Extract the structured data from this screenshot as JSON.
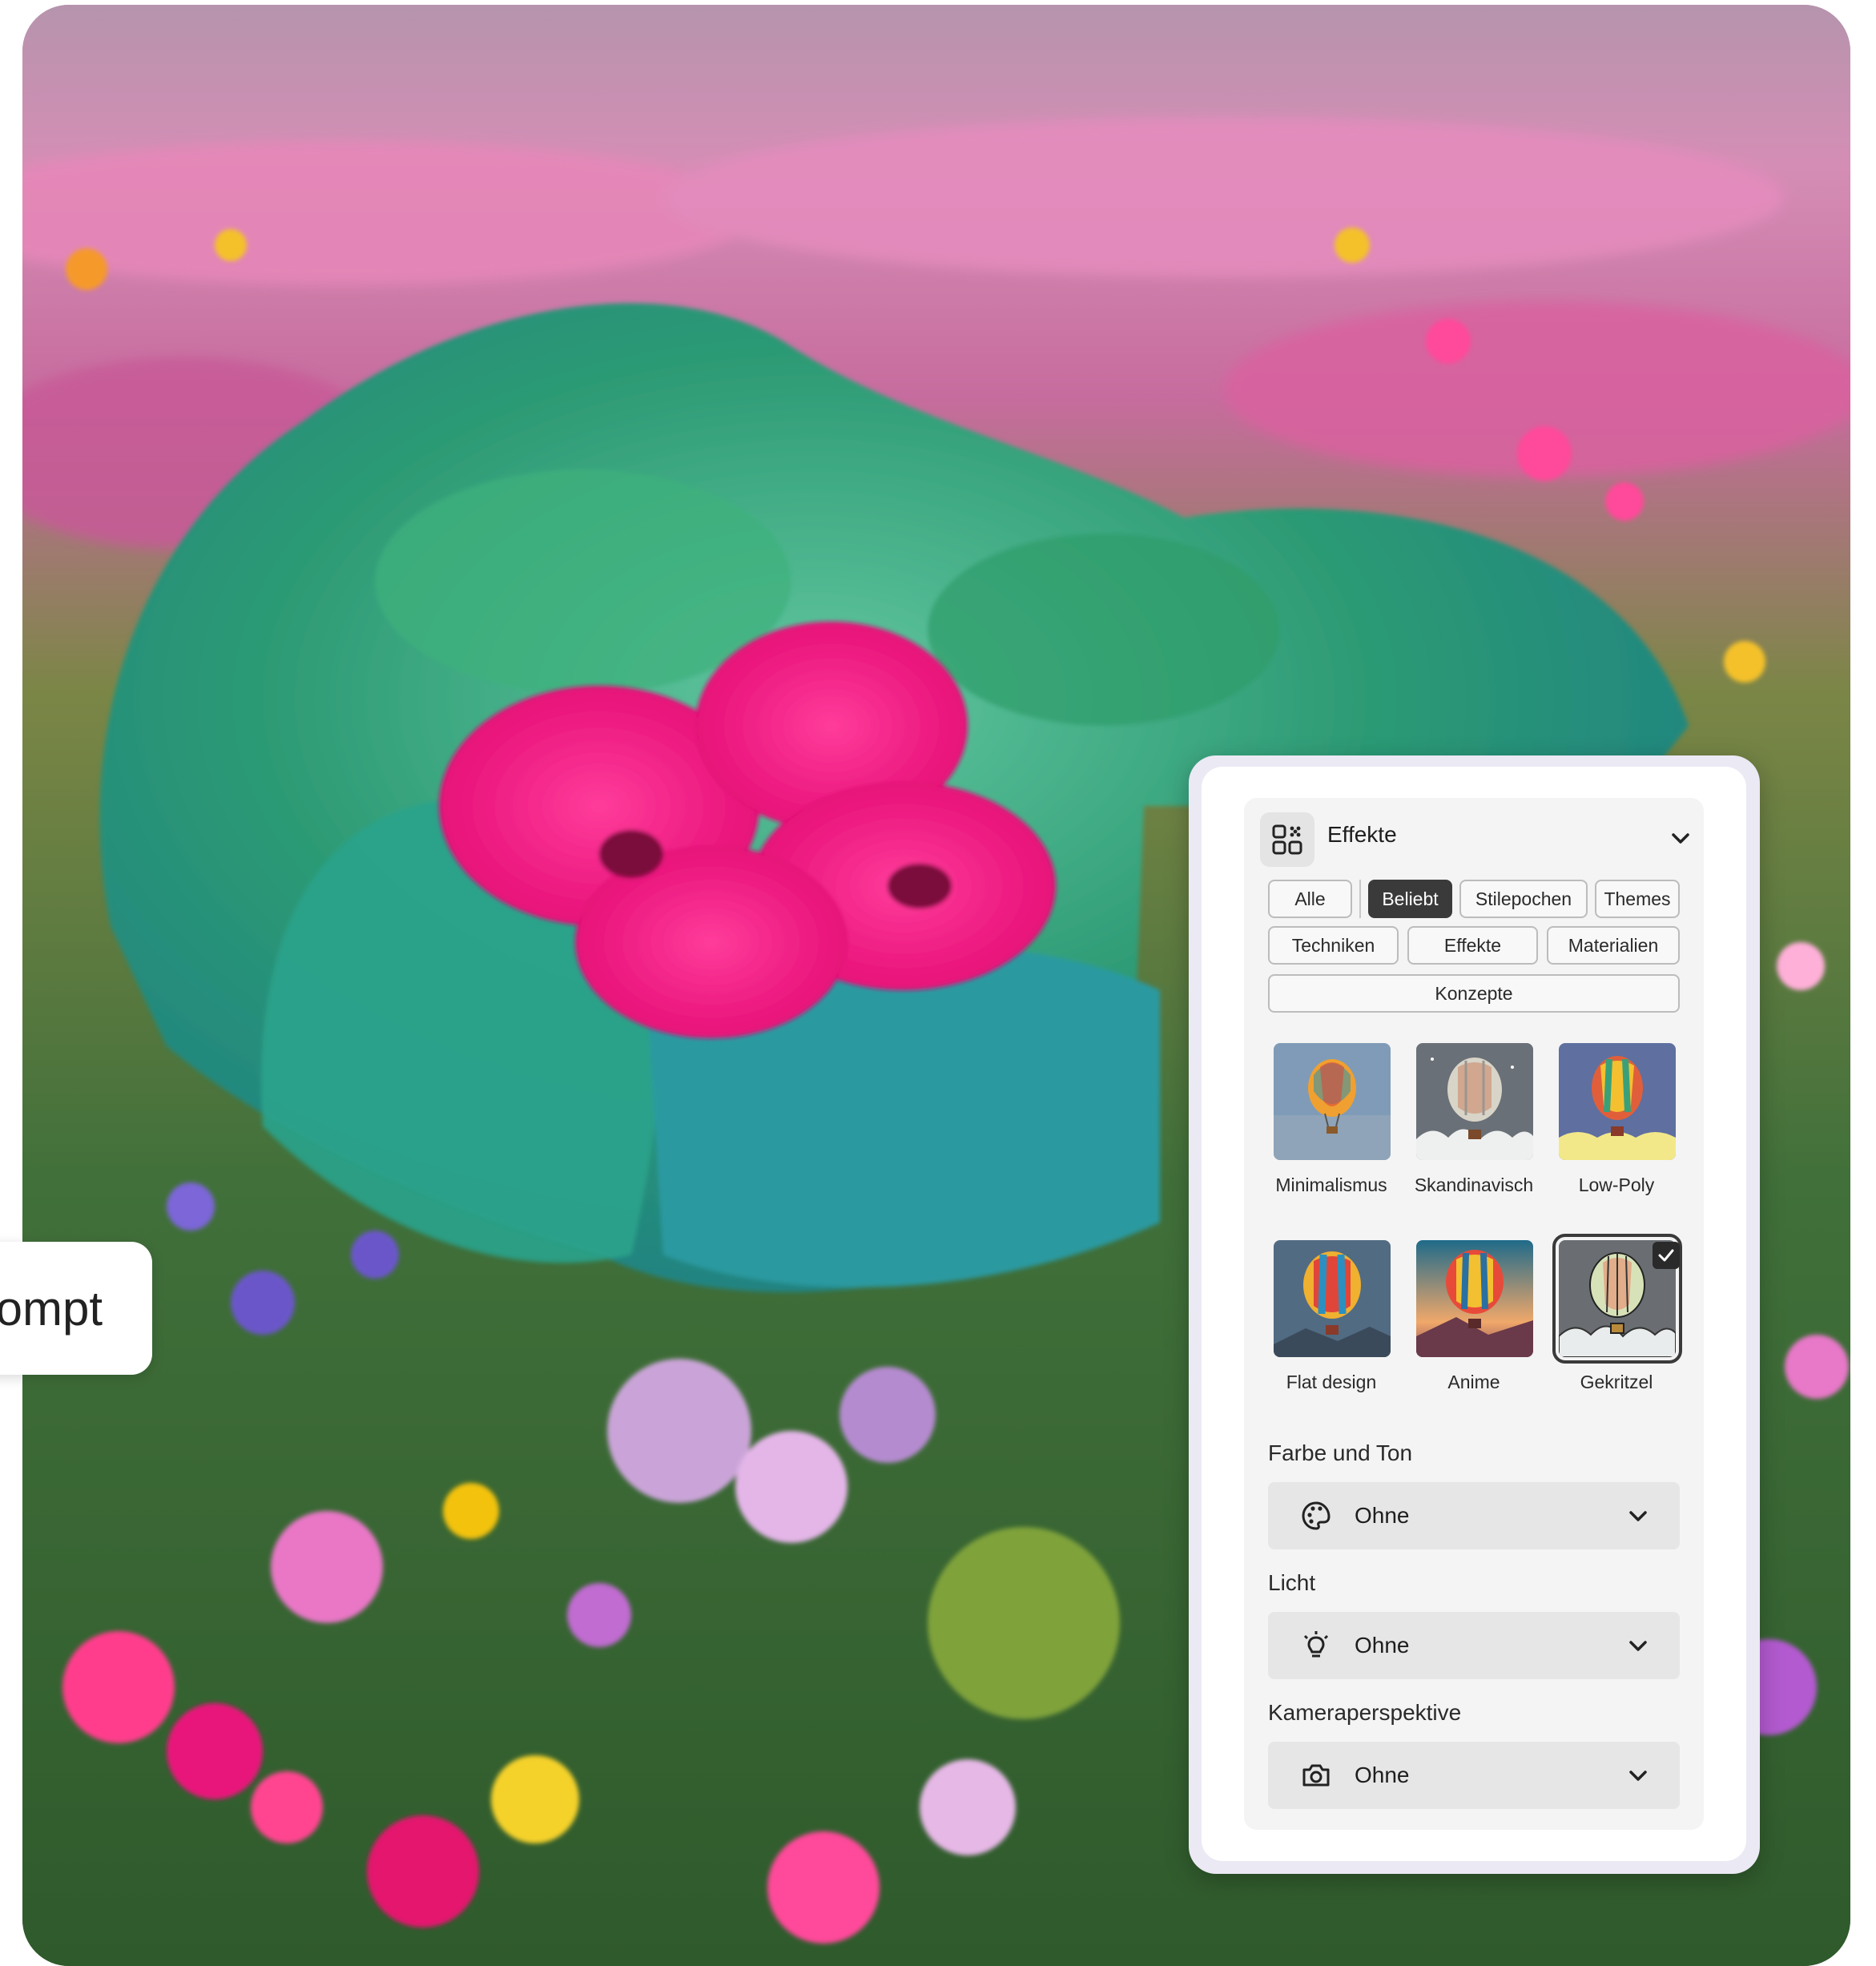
{
  "prompt_pill": {
    "text": "ompt"
  },
  "panel": {
    "header": {
      "title": "Effekte",
      "icon": "effects-grid-icon",
      "chevron": "chevron-down-icon"
    },
    "filter_chips": [
      {
        "label": "Alle",
        "active": false
      },
      {
        "label": "Beliebt",
        "active": true
      },
      {
        "label": "Stilepochen",
        "active": false
      },
      {
        "label": "Themes",
        "active": false
      },
      {
        "label": "Techniken",
        "active": false
      },
      {
        "label": "Effekte",
        "active": false
      },
      {
        "label": "Materialien",
        "active": false
      },
      {
        "label": "Konzepte",
        "active": false
      }
    ],
    "styles": [
      {
        "label": "Minimalismus",
        "selected": false
      },
      {
        "label": "Skandinavisch",
        "selected": false
      },
      {
        "label": "Low-Poly",
        "selected": false
      },
      {
        "label": "Flat design",
        "selected": false
      },
      {
        "label": "Anime",
        "selected": false
      },
      {
        "label": "Gekritzel",
        "selected": true
      }
    ],
    "sections": [
      {
        "label": "Farbe und Ton",
        "value": "Ohne",
        "icon": "palette-icon"
      },
      {
        "label": "Licht",
        "value": "Ohne",
        "icon": "lightbulb-icon"
      },
      {
        "label": "Kameraperspektive",
        "value": "Ohne",
        "icon": "camera-icon"
      }
    ]
  },
  "colors": {
    "accent_active": "#3a3a3a",
    "panel_bg": "#ffffff",
    "inner_bg": "#f4f4f4",
    "dropdown_bg": "#e6e6e6"
  }
}
